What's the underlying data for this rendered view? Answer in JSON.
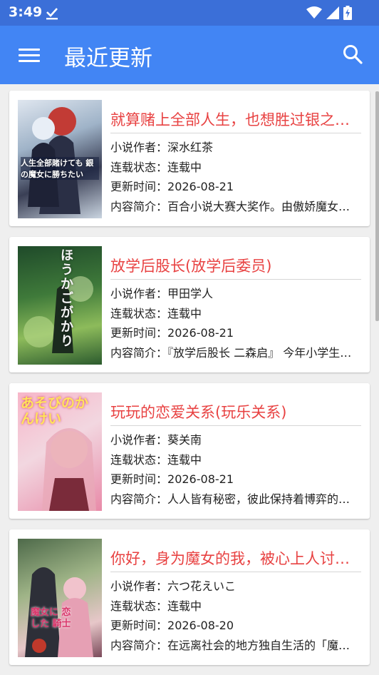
{
  "status": {
    "time": "3:49"
  },
  "toolbar": {
    "title": "最近更新"
  },
  "labels": {
    "author": "小说作者：",
    "status": "连载状态：",
    "updated": "更新时间：",
    "summary": "内容简介："
  },
  "books": [
    {
      "title": "就算赌上全部人生，也想胜过银之魔女",
      "author": "深水红茶",
      "status": "连载中",
      "updated": "2026-08-21",
      "summary": "百合小说大赛大奖作。由傲娇魔女与少女展开的故事",
      "cover_text": "人生全部賭けても 銀の魔女に勝ちたい"
    },
    {
      "title": "放学后股长(放学后委员)",
      "author": "甲田学人",
      "status": "连载中",
      "updated": "2026-08-21",
      "summary": "『放学后股长 二森启』 今年小学生的故事",
      "cover_text": "ほうかご がかり"
    },
    {
      "title": "玩玩的恋爱关系(玩乐关系)",
      "author": "葵关南",
      "status": "连载中",
      "updated": "2026-08-21",
      "summary": "人人皆有秘密，彼此保持着博弈的关系",
      "cover_text": "あそびのかんけい"
    },
    {
      "title": "你好，身为魔女的我，被心上人讨厌了",
      "author": "六つ花えいこ",
      "status": "连载中",
      "updated": "2026-08-20",
      "summary": "在远离社会的地方独自生活的「魔女」",
      "cover_text": "魔女に 恋した 騎士"
    }
  ]
}
